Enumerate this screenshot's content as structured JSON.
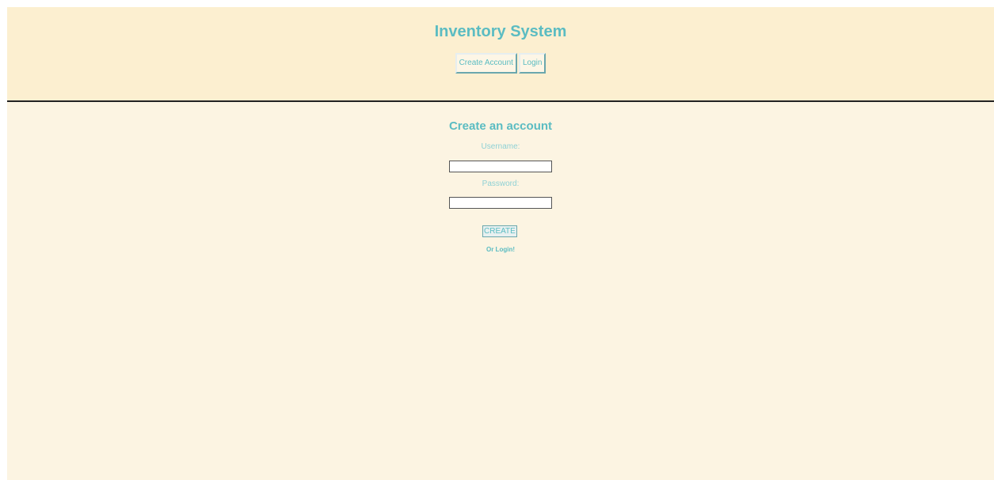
{
  "header": {
    "title": "Inventory System",
    "nav": {
      "create_account_label": "Create Account",
      "login_label": "Login"
    }
  },
  "form": {
    "title": "Create an account",
    "username_label": "Username:",
    "username_value": "",
    "password_label": "Password:",
    "password_value": "",
    "submit_label": "CREATE",
    "login_link_label": "Or Login!"
  },
  "colors": {
    "accent": "#5bbcc2",
    "header_bg": "#fcefd0",
    "page_bg": "#fcf4e2",
    "divider": "#222222"
  }
}
